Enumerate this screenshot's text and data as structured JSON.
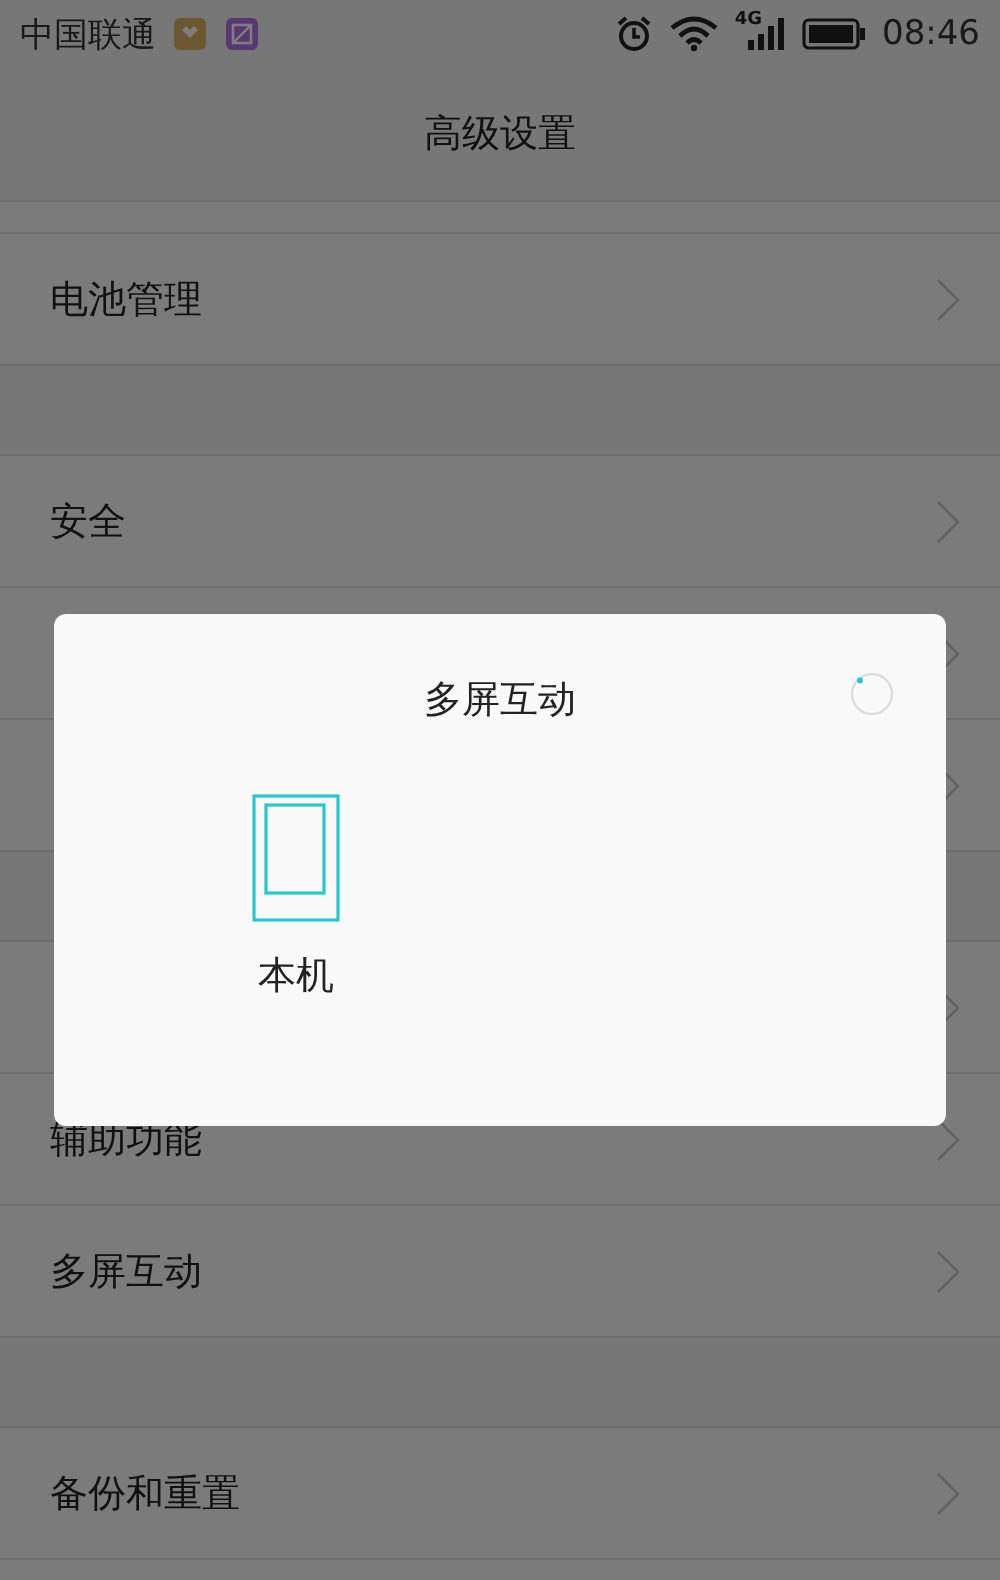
{
  "status_bar": {
    "carrier": "中国联通",
    "network": "4G",
    "time": "08:46"
  },
  "header": {
    "title": "高级设置"
  },
  "groups": [
    {
      "rows": [
        {
          "kind": "partial"
        },
        {
          "kind": "row",
          "label": "电池管理"
        }
      ]
    },
    {
      "rows": [
        {
          "kind": "row",
          "label": "安全"
        },
        {
          "kind": "row"
        },
        {
          "kind": "row"
        }
      ]
    },
    {
      "rows": [
        {
          "kind": "row"
        },
        {
          "kind": "row",
          "label": "辅助功能"
        },
        {
          "kind": "row",
          "label": "多屏互动"
        }
      ]
    },
    {
      "rows": [
        {
          "kind": "row",
          "label": "备份和重置"
        },
        {
          "kind": "partial"
        }
      ]
    }
  ],
  "dialog": {
    "title": "多屏互动",
    "loading": true,
    "devices": [
      {
        "label": "本机"
      }
    ]
  }
}
